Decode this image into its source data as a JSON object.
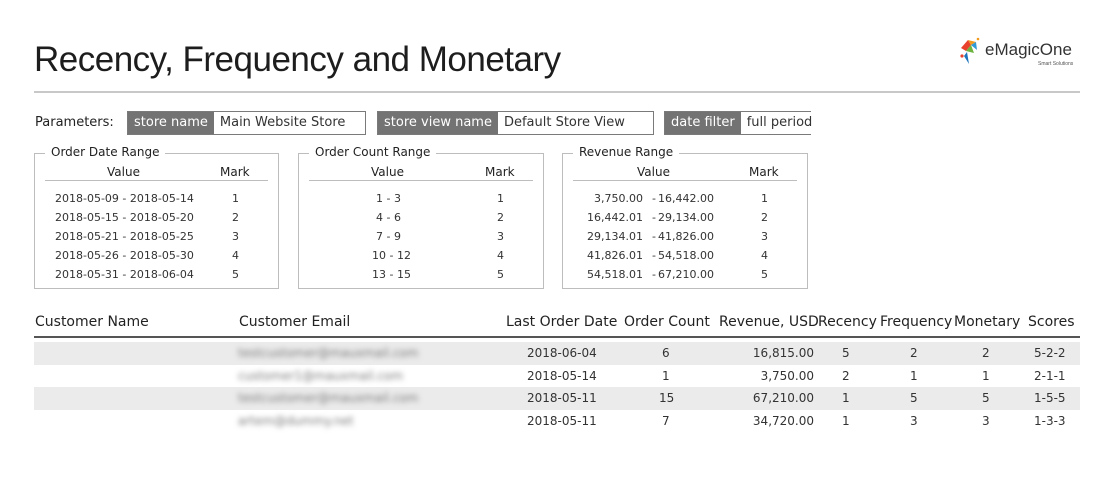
{
  "report": {
    "title": "Recency, Frequency and Monetary",
    "logo_text": "eMagicOne",
    "logo_subtext": "Smart Solutions",
    "logo_icon": "magic-wand-icon"
  },
  "parameters": {
    "label": "Parameters:",
    "items": [
      {
        "name": "store name",
        "value": "Main Website Store"
      },
      {
        "name": "store view name",
        "value": "Default Store View"
      },
      {
        "name": "date filter",
        "value": "full period"
      }
    ]
  },
  "ranges": {
    "value_header": "Value",
    "mark_header": "Mark",
    "order_date": {
      "title": "Order Date Range",
      "rows": [
        {
          "value": "2018-05-09 - 2018-05-14",
          "mark": "1"
        },
        {
          "value": "2018-05-15 - 2018-05-20",
          "mark": "2"
        },
        {
          "value": "2018-05-21 - 2018-05-25",
          "mark": "3"
        },
        {
          "value": "2018-05-26 - 2018-05-30",
          "mark": "4"
        },
        {
          "value": "2018-05-31 - 2018-06-04",
          "mark": "5"
        }
      ]
    },
    "order_count": {
      "title": "Order Count Range",
      "rows": [
        {
          "value": "1 - 3",
          "mark": "1"
        },
        {
          "value": "4 - 6",
          "mark": "2"
        },
        {
          "value": "7 - 9",
          "mark": "3"
        },
        {
          "value": "10 - 12",
          "mark": "4"
        },
        {
          "value": "13 - 15",
          "mark": "5"
        }
      ]
    },
    "revenue": {
      "title": "Revenue Range",
      "rows": [
        {
          "from": "3,750.00",
          "sep": "-",
          "to": "16,442.00",
          "mark": "1"
        },
        {
          "from": "16,442.01",
          "sep": "-",
          "to": "29,134.00",
          "mark": "2"
        },
        {
          "from": "29,134.01",
          "sep": "-",
          "to": "41,826.00",
          "mark": "3"
        },
        {
          "from": "41,826.01",
          "sep": "-",
          "to": "54,518.00",
          "mark": "4"
        },
        {
          "from": "54,518.01",
          "sep": "-",
          "to": "67,210.00",
          "mark": "5"
        }
      ]
    }
  },
  "table": {
    "columns": [
      "Customer Name",
      "Customer Email",
      "Last Order Date",
      "Order Count",
      "Revenue, USD",
      "Recency",
      "Frequency",
      "Monetary",
      "Scores"
    ],
    "rows": [
      {
        "name": "",
        "email": "testcustomer@mauxmail.com",
        "last_order": "2018-06-04",
        "count": "6",
        "revenue": "16,815.00",
        "recency": "5",
        "frequency": "2",
        "monetary": "2",
        "scores": "5-2-2"
      },
      {
        "name": "",
        "email": "customer1@mauxmail.com",
        "last_order": "2018-05-14",
        "count": "1",
        "revenue": "3,750.00",
        "recency": "2",
        "frequency": "1",
        "monetary": "1",
        "scores": "2-1-1"
      },
      {
        "name": "",
        "email": "testcustomer@mauxmail.com",
        "last_order": "2018-05-11",
        "count": "15",
        "revenue": "67,210.00",
        "recency": "1",
        "frequency": "5",
        "monetary": "5",
        "scores": "1-5-5"
      },
      {
        "name": "",
        "email": "artem@dummy.net",
        "last_order": "2018-05-11",
        "count": "7",
        "revenue": "34,720.00",
        "recency": "1",
        "frequency": "3",
        "monetary": "3",
        "scores": "1-3-3"
      }
    ]
  }
}
